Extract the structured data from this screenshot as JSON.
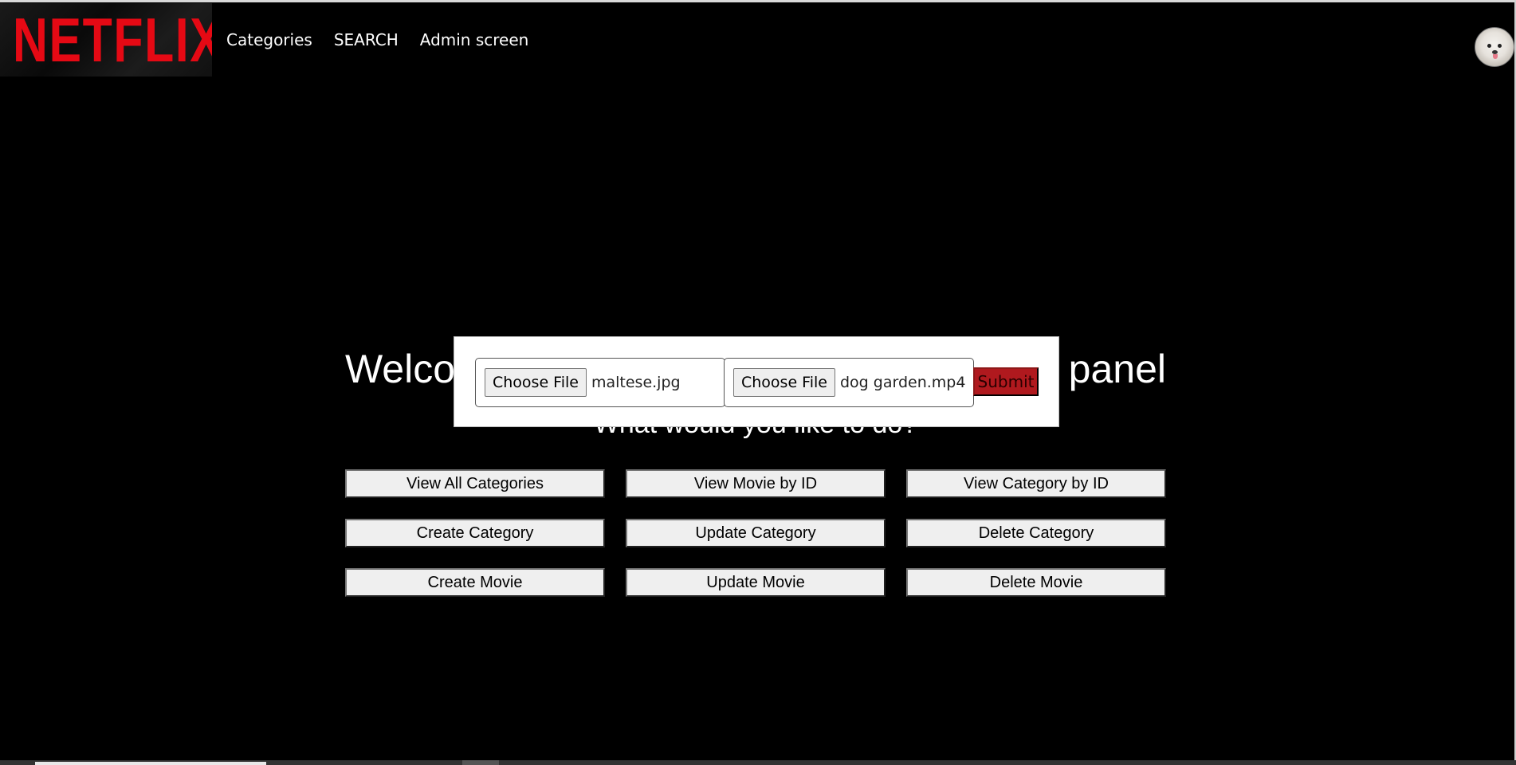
{
  "brand": {
    "logo_text": "NETFLIX",
    "logo_color": "#e50914"
  },
  "nav": {
    "items": [
      "Categories",
      "SEARCH",
      "Admin screen"
    ]
  },
  "user": {
    "avatar_icon": "maltese-dog-avatar"
  },
  "welcome": {
    "left_text": "Welco",
    "right_text": "panel",
    "subtitle": "What would you like to do?"
  },
  "actions": [
    "View All Categories",
    "View Movie by ID",
    "View Category by ID",
    "Create Category",
    "Update Category",
    "Delete Category",
    "Create Movie",
    "Update Movie",
    "Delete Movie"
  ],
  "upload_modal": {
    "image_input": {
      "button_label": "Choose File",
      "file_name": "maltese.jpg"
    },
    "video_input": {
      "button_label": "Choose File",
      "file_name": "dog garden.mp4"
    },
    "submit_label": "Submit",
    "submit_color": "#b0191e"
  }
}
